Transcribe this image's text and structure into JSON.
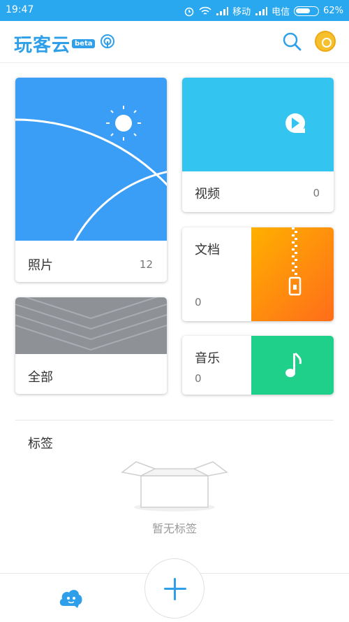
{
  "status": {
    "time": "19:47",
    "carrier1": "移动",
    "carrier2": "电信",
    "battery": "62%"
  },
  "header": {
    "brand": "玩客云",
    "beta": "beta"
  },
  "cards": {
    "photos": {
      "label": "照片",
      "count": "12"
    },
    "video": {
      "label": "视频",
      "count": "0"
    },
    "docs": {
      "label": "文档",
      "count": "0"
    },
    "all": {
      "label": "全部"
    },
    "music": {
      "label": "音乐",
      "count": "0"
    }
  },
  "tags": {
    "title": "标签",
    "empty_text": "暂无标签"
  },
  "colors": {
    "accent": "#2e9fe8",
    "status_bar": "#29a8f0",
    "photos": "#3a9ef6",
    "video": "#33c4f0",
    "docs": "#ff8a00",
    "music": "#1fd08a",
    "all": "#8e9297"
  },
  "icons": [
    "alarm-icon",
    "wifi-icon",
    "signal-icon",
    "cast-icon",
    "search-icon",
    "coin-icon",
    "sun-icon",
    "play-icon",
    "zipper-icon",
    "music-note-icon",
    "box-icon",
    "plus-icon",
    "cloud-face-icon"
  ]
}
